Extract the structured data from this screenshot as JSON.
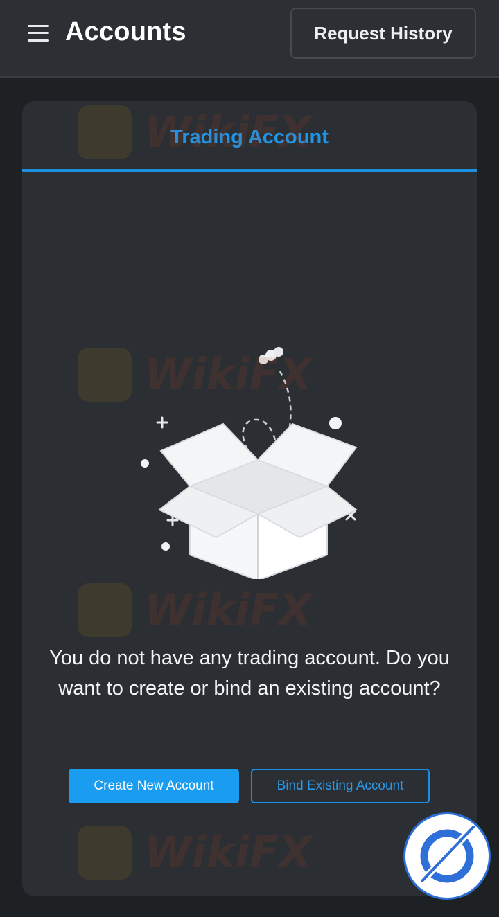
{
  "header": {
    "title": "Accounts",
    "menu_icon": "hamburger-menu-icon",
    "request_history_label": "Request History"
  },
  "card": {
    "tab_label": "Trading Account",
    "empty_message": "You do not have any trading account. Do you want to create or bind an existing account?",
    "illustration_icon": "empty-box-icon",
    "create_button_label": "Create New Account",
    "bind_button_label": "Bind Existing Account"
  },
  "watermark": {
    "text": "WikiFX"
  },
  "fab": {
    "icon": "wikifx-logo-icon"
  },
  "colors": {
    "accent": "#1a9cf0",
    "header_bg": "#2c2f33",
    "card_bg": "#2b2e32",
    "page_bg": "#1e2124"
  }
}
